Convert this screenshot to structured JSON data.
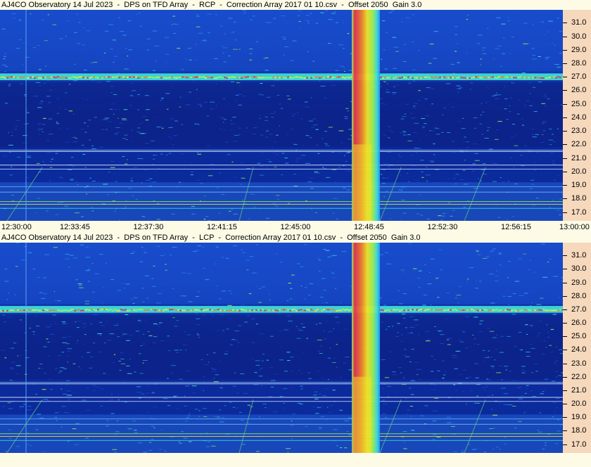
{
  "panels": [
    {
      "title": "AJ4CO Observatory 14 Jul 2023  -  DPS on TFD Array  -  RCP  -  Correction Array 2017 01 10.csv  -  Offset 2050  Gain 3.0",
      "polarization": "RCP"
    },
    {
      "title": "AJ4CO Observatory 14 Jul 2023  -  DPS on TFD Array  -  LCP  -  Correction Array 2017 01 10.csv  -  Offset 2050  Gain 3.0",
      "polarization": "LCP"
    }
  ],
  "chart_data": {
    "type": "heatmap",
    "freq_ticks": [
      "31.0",
      "30.0",
      "29.0",
      "28.0",
      "27.0",
      "26.0",
      "25.0",
      "24.0",
      "23.0",
      "22.0",
      "21.0",
      "20.0",
      "19.0",
      "18.0",
      "17.0"
    ],
    "freq_values": [
      31,
      30,
      29,
      28,
      27,
      26,
      25,
      24,
      23,
      22,
      21,
      20,
      19,
      18,
      17
    ],
    "time_ticks": [
      "12:30:00",
      "12:33:45",
      "12:37:30",
      "12:41:15",
      "12:45:00",
      "12:48:45",
      "12:52:30",
      "12:56:15",
      "13:00:00"
    ],
    "ylim": [
      16.35,
      31.95
    ],
    "xlim": [
      "12:30:00",
      "13:00:00"
    ],
    "colormap": [
      "#0a1e8c",
      "#1e46d2",
      "#2896f0",
      "#3cdcdc",
      "#a0f050",
      "#f0e628",
      "#f08228",
      "#e63250"
    ],
    "features": {
      "interference_band_mhz": 27.0,
      "burst_start": "12:48:45",
      "burst_end": "12:50:15"
    }
  }
}
